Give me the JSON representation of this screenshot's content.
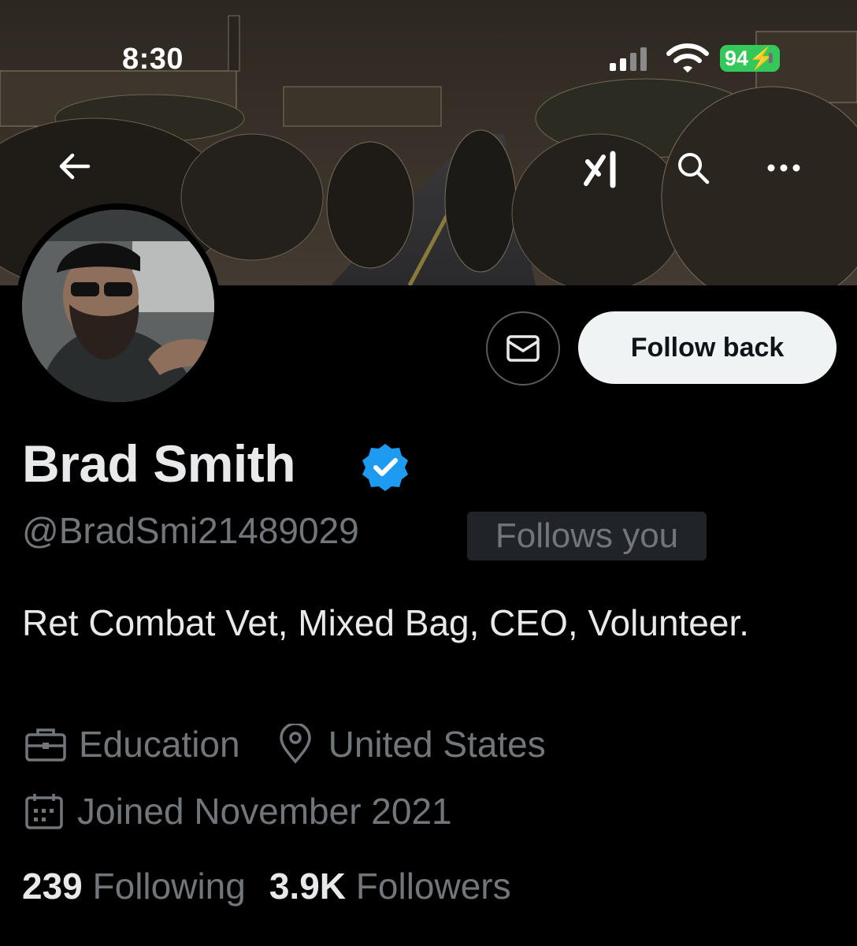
{
  "status_bar": {
    "time": "8:30",
    "battery": "94"
  },
  "profile": {
    "name": "Brad Smith",
    "handle": "@BradSmi21489029",
    "follows_you": "Follows you",
    "bio": "Ret Combat Vet, Mixed Bag, CEO, Volunteer.",
    "profession": "Education",
    "location": "United States",
    "joined": "Joined November 2021",
    "following_count": "239",
    "following_label": "Following",
    "followers_count": "3.9K",
    "followers_label": "Followers"
  },
  "actions": {
    "follow_back": "Follow back"
  },
  "colors": {
    "verified": "#1d9bf0",
    "battery": "#34c759",
    "muted": "#71767b"
  }
}
